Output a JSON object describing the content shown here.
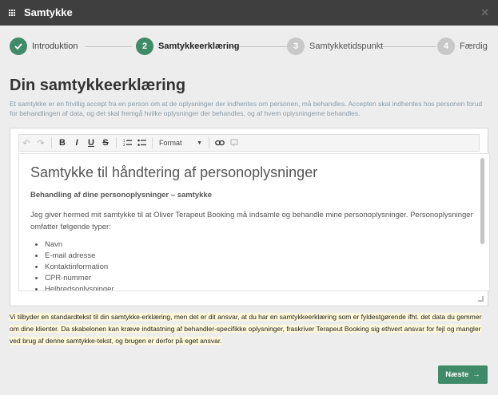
{
  "window": {
    "title": "Samtykke"
  },
  "stepper": {
    "steps": [
      {
        "number": "1",
        "label": "Introduktion",
        "state": "done"
      },
      {
        "number": "2",
        "label": "Samtykkeerklæring",
        "state": "active"
      },
      {
        "number": "3",
        "label": "Samtykketidspunkt",
        "state": "todo"
      },
      {
        "number": "4",
        "label": "Færdig",
        "state": "todo"
      }
    ]
  },
  "main": {
    "title": "Din samtykkeerklæring",
    "intro": "Et samtykke er en frivillig accept fra en person om at de oplysninger der indhentes om personen, må behandles. Accepten skal indhentes hos personen forud for behandlingen af data, og det skal fremgå hvilke oplysninger der behandles, og af hvem oplysningerne behandles."
  },
  "editor": {
    "toolbar": {
      "undo": "↶",
      "redo": "↷",
      "bold": "B",
      "italic": "I",
      "underline": "U",
      "strike": "S",
      "format_label": "Format"
    },
    "content": {
      "heading": "Samtykke til håndtering af personoplysninger",
      "subheading": "Behandling af dine personoplysninger – samtykke",
      "paragraph": "Jeg giver hermed mit samtykke til at Oliver Terapeut Booking må indsamle og behandle mine personoplysninger. Personoplysninger omfatter følgende typer:",
      "list": [
        "Navn",
        "E-mail adresse",
        "Kontaktinformation",
        "CPR-nummer",
        "Helbredsoplysninger"
      ]
    }
  },
  "disclaimer": "Vi tilbyder en standardtekst til din samtykke-erklæring, men det er dit ansvar, at du har en samtykkeerklæring som er fyldestgørende ifht. det data du gemmer om dine klienter. Da skabelonen kan kræve indtastning af behandler-specifikke oplysninger, fraskriver Terapeut Booking sig ethvert ansvar for fejl og mangler ved brug af denne samtykke-tekst, og brugen er derfor på eget ansvar.",
  "footer": {
    "next_label": "Næste",
    "next_arrow": "→"
  },
  "colors": {
    "accent": "#3f8a68",
    "titlebar": "#3f3f3f",
    "highlight": "#fff8d9"
  },
  "icons": [
    "grid-icon",
    "close-icon",
    "check-icon",
    "undo-icon",
    "redo-icon",
    "ordered-list-icon",
    "bullet-list-icon",
    "link-icon",
    "unlink-icon",
    "arrow-right-icon"
  ]
}
